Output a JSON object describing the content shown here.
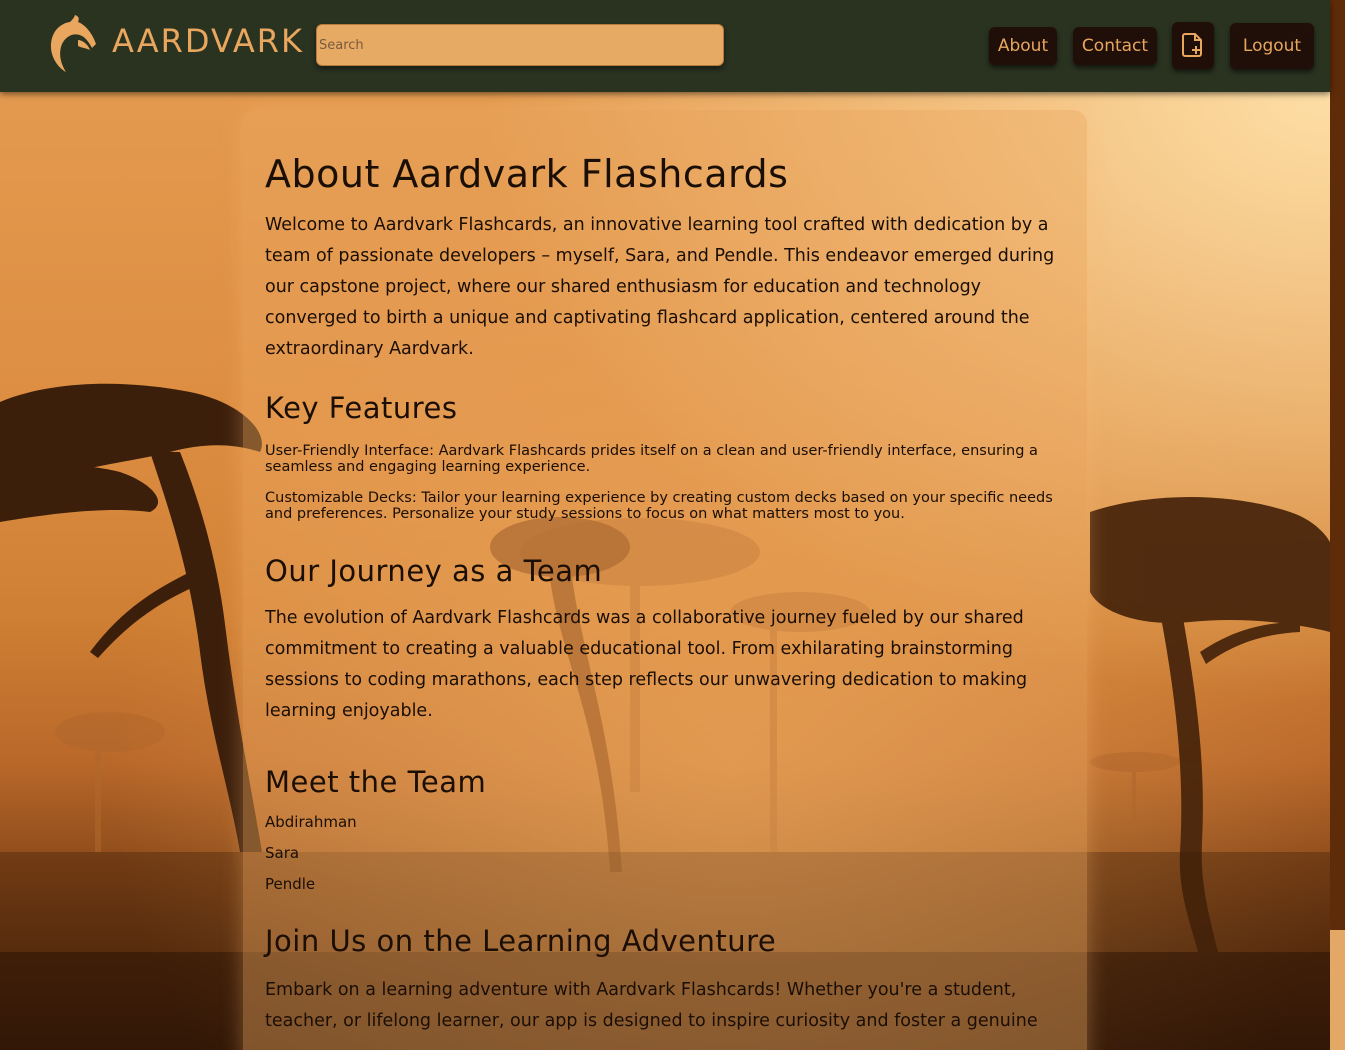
{
  "navbar": {
    "brand": "AARDVARK",
    "search_placeholder": "Search",
    "about_label": "About",
    "contact_label": "Contact",
    "logout_label": "Logout"
  },
  "about": {
    "title": "About Aardvark Flashcards",
    "intro": "Welcome to Aardvark Flashcards, an innovative learning tool crafted with dedication by a team of passionate developers – myself, Sara, and Pendle. This endeavor emerged during our capstone project, where our shared enthusiasm for education and technology converged to birth a unique and captivating flashcard application, centered around the extraordinary Aardvark.",
    "features_heading": "Key Features",
    "features": [
      "User-Friendly Interface: Aardvark Flashcards prides itself on a clean and user-friendly interface, ensuring a seamless and engaging learning experience.",
      "Customizable Decks: Tailor your learning experience by creating custom decks based on your specific needs and preferences. Personalize your study sessions to focus on what matters most to you."
    ],
    "journey_heading": "Our Journey as a Team",
    "journey_text": "The evolution of Aardvark Flashcards was a collaborative journey fueled by our shared commitment to creating a valuable educational tool. From exhilarating brainstorming sessions to coding marathons, each step reflects our unwavering dedication to making learning enjoyable.",
    "team_heading": "Meet the Team",
    "team": [
      "Abdirahman",
      "Sara",
      "Pendle"
    ],
    "join_heading": "Join Us on the Learning Adventure",
    "join_text": "Embark on a learning adventure with Aardvark Flashcards! Whether you're a student, teacher, or lifelong learner, our app is designed to inspire curiosity and foster a genuine"
  },
  "colors": {
    "navbar_bg": "#2a3220",
    "accent": "#e8a65e",
    "button_bg": "#1f0f08",
    "search_bg": "#e7aa65"
  },
  "icons": {
    "logo": "aardvark-logo-icon",
    "new_deck": "file-plus-icon"
  }
}
